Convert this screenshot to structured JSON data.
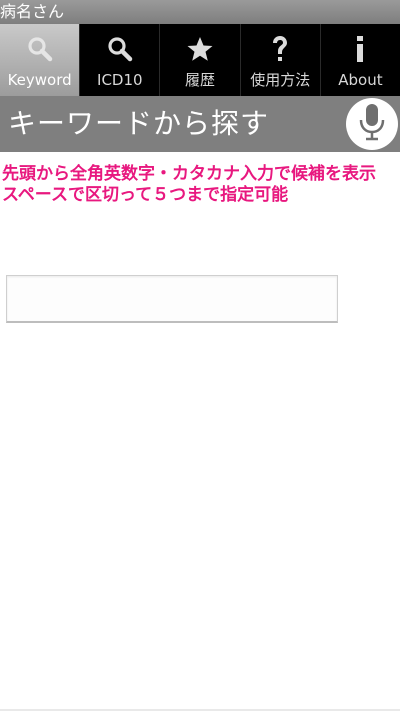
{
  "app": {
    "title": "病名さん"
  },
  "tabs": [
    {
      "label": "Keyword",
      "icon": "search-icon",
      "active": true
    },
    {
      "label": "ICD10",
      "icon": "search-icon",
      "active": false
    },
    {
      "label": "履歴",
      "icon": "star-icon",
      "active": false
    },
    {
      "label": "使用方法",
      "icon": "question-icon",
      "active": false
    },
    {
      "label": "About",
      "icon": "info-icon",
      "active": false
    }
  ],
  "header": {
    "title": "キーワードから探す",
    "mic_icon": "microphone-icon"
  },
  "instructions": {
    "line1": "先頭から全角英数字・カタカナ入力で候補を表示",
    "line2": "スペースで区切って５つまで指定可能"
  },
  "search": {
    "value": "",
    "placeholder": ""
  },
  "colors": {
    "instruction_text": "#e8187f",
    "header_band": "#7f7f7f",
    "tab_bar": "#000000",
    "active_tab": "#b3b3b3"
  }
}
